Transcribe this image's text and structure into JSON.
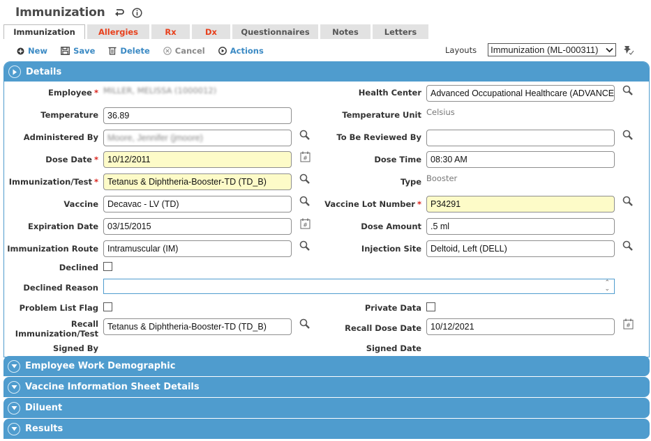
{
  "header": {
    "title": "Immunization",
    "back_icon": "return-arrow-icon",
    "info_icon": "info-icon"
  },
  "tabs": [
    {
      "label": "Immunization",
      "active": true,
      "alert": false
    },
    {
      "label": "Allergies",
      "active": false,
      "alert": true
    },
    {
      "label": "Rx",
      "active": false,
      "alert": true
    },
    {
      "label": "Dx",
      "active": false,
      "alert": true
    },
    {
      "label": "Questionnaires",
      "active": false,
      "alert": false
    },
    {
      "label": "Notes",
      "active": false,
      "alert": false
    },
    {
      "label": "Letters",
      "active": false,
      "alert": false
    }
  ],
  "toolbar": {
    "new_label": "New",
    "save_label": "Save",
    "delete_label": "Delete",
    "cancel_label": "Cancel",
    "actions_label": "Actions",
    "layouts_label": "Layouts",
    "layouts_selected": "Immunization (ML-000311)"
  },
  "details": {
    "title": "Details",
    "fields": {
      "employee": {
        "label": "Employee",
        "value": "MILLER, MELISSA (1000012)",
        "required": true
      },
      "health_center": {
        "label": "Health Center",
        "value": "Advanced Occupational Healthcare (ADVANCED"
      },
      "temperature": {
        "label": "Temperature",
        "value": "36.89"
      },
      "temperature_unit": {
        "label": "Temperature Unit",
        "value": "Celsius"
      },
      "administered_by": {
        "label": "Administered By",
        "value": "Moore, Jennifer (jmoore)"
      },
      "to_be_reviewed_by": {
        "label": "To Be Reviewed By",
        "value": ""
      },
      "dose_date": {
        "label": "Dose Date",
        "value": "10/12/2011",
        "required": true
      },
      "dose_time": {
        "label": "Dose Time",
        "value": "08:30 AM"
      },
      "immunization_test": {
        "label": "Immunization/Test",
        "value": "Tetanus & Diphtheria-Booster-TD (TD_B)",
        "required": true
      },
      "type": {
        "label": "Type",
        "value": "Booster"
      },
      "vaccine": {
        "label": "Vaccine",
        "value": "Decavac - LV (TD)"
      },
      "vaccine_lot_number": {
        "label": "Vaccine Lot Number",
        "value": "P34291",
        "required": true
      },
      "expiration_date": {
        "label": "Expiration Date",
        "value": "03/15/2015"
      },
      "dose_amount": {
        "label": "Dose Amount",
        "value": ".5 ml"
      },
      "immunization_route": {
        "label": "Immunization Route",
        "value": "Intramuscular (IM)"
      },
      "injection_site": {
        "label": "Injection Site",
        "value": "Deltoid, Left (DELL)"
      },
      "declined": {
        "label": "Declined",
        "checked": false
      },
      "declined_reason": {
        "label": "Declined Reason",
        "value": ""
      },
      "problem_list_flag": {
        "label": "Problem List Flag",
        "checked": false
      },
      "private_data": {
        "label": "Private Data",
        "checked": false
      },
      "recall_immunization_line1": "Recall",
      "recall_immunization_line2": "Immunization/Test",
      "recall_immunization_value": "Tetanus & Diphtheria-Booster-TD (TD_B)",
      "recall_dose_date": {
        "label": "Recall Dose Date",
        "value": "10/12/2021"
      },
      "signed_by": {
        "label": "Signed By",
        "value": ""
      },
      "signed_date": {
        "label": "Signed Date",
        "value": ""
      }
    }
  },
  "sections": [
    {
      "title": "Employee Work Demographic"
    },
    {
      "title": "Vaccine Information Sheet Details"
    },
    {
      "title": "Diluent"
    },
    {
      "title": "Results"
    }
  ],
  "colors": {
    "accent": "#4f9cce",
    "alert_tab": "#e8401c",
    "required_star": "#d9231c",
    "required_field_bg": "#fdfbc8",
    "link": "#3b8ac4"
  }
}
